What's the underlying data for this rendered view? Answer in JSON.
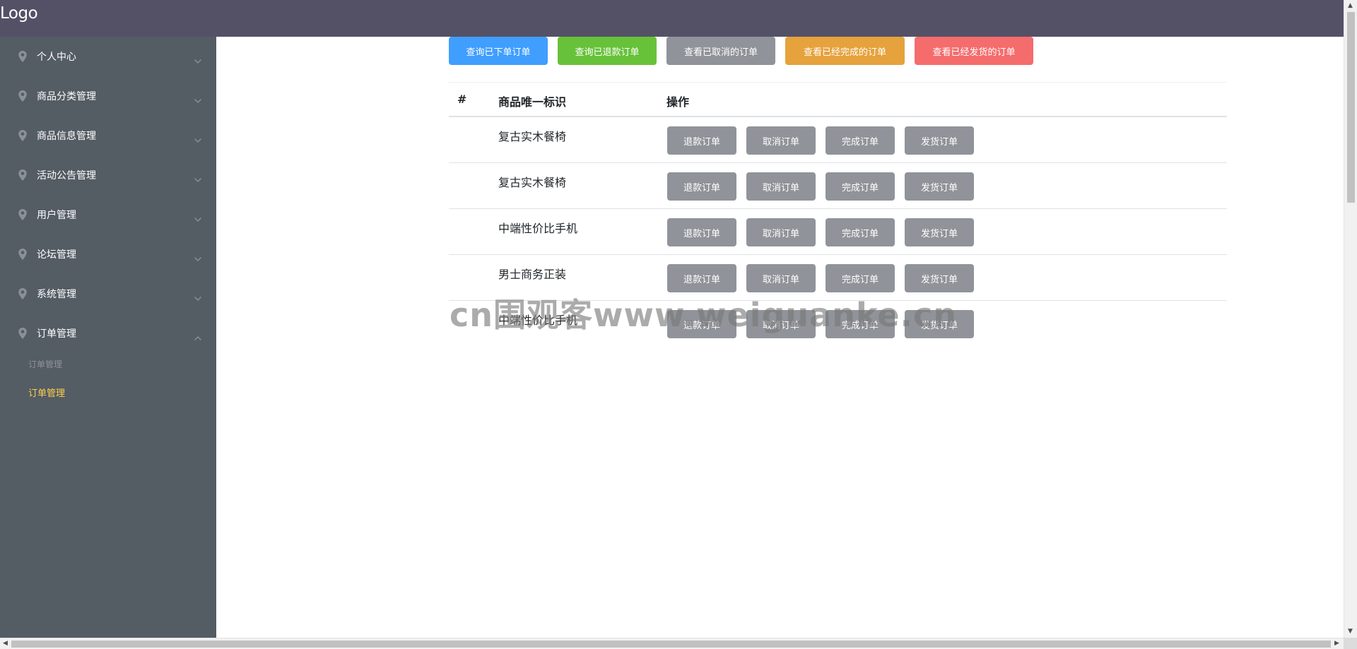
{
  "header": {
    "logo": "Logo",
    "bg_color": "#545167"
  },
  "sidebar": {
    "bg_color": "#545c64",
    "items": [
      {
        "label": "个人中心",
        "icon": "location-pin-icon",
        "expanded": false
      },
      {
        "label": "商品分类管理",
        "icon": "location-pin-icon",
        "expanded": false
      },
      {
        "label": "商品信息管理",
        "icon": "location-pin-icon",
        "expanded": false
      },
      {
        "label": "活动公告管理",
        "icon": "location-pin-icon",
        "expanded": false
      },
      {
        "label": "用户管理",
        "icon": "location-pin-icon",
        "expanded": false
      },
      {
        "label": "论坛管理",
        "icon": "location-pin-icon",
        "expanded": false
      },
      {
        "label": "系统管理",
        "icon": "location-pin-icon",
        "expanded": false
      },
      {
        "label": "订单管理",
        "icon": "location-pin-icon",
        "expanded": true
      }
    ],
    "submenu": {
      "group_title": "订单管理",
      "active_item": "订单管理",
      "active_color": "#ffd04b"
    }
  },
  "filters": [
    {
      "label": "查询已下单订单",
      "color": "#409eff"
    },
    {
      "label": "查询已退款订单",
      "color": "#67c23a"
    },
    {
      "label": "查看已取消的订单",
      "color": "#909399"
    },
    {
      "label": "查看已经完成的订单",
      "color": "#e6a23c"
    },
    {
      "label": "查看已经发货的订单",
      "color": "#f56c6c"
    }
  ],
  "table": {
    "headers": [
      "#",
      "商品唯一标识",
      "操作"
    ],
    "rows": [
      {
        "product": "复古实木餐椅"
      },
      {
        "product": "复古实木餐椅"
      },
      {
        "product": "中端性价比手机"
      },
      {
        "product": "男士商务正装"
      },
      {
        "product": "中端性价比手机"
      }
    ],
    "actions": [
      "退款订单",
      "取消订单",
      "完成订单",
      "发货订单"
    ],
    "action_color": "#909399"
  },
  "watermark": "cn围观客www.weiguanke.cn"
}
